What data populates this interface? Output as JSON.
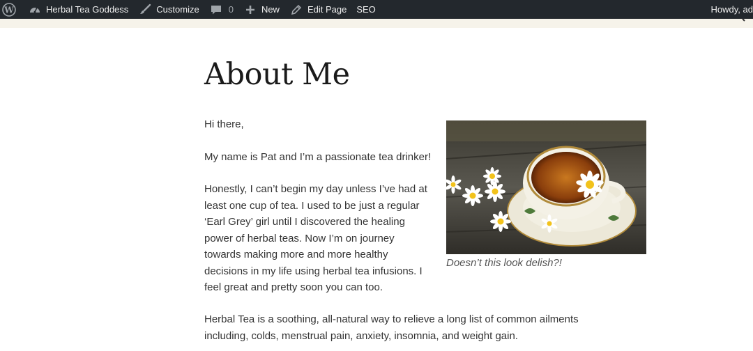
{
  "adminbar": {
    "wp_logo_icon": "wordpress-logo-icon",
    "site_name": "Herbal Tea Goddess",
    "customize": "Customize",
    "comments_count": "0",
    "new": "New",
    "edit_page": "Edit Page",
    "seo": "SEO",
    "howdy": "Howdy, ad"
  },
  "page": {
    "title": "About Me",
    "paragraphs": [
      "Hi there,",
      "My name is Pat and I’m a passionate tea drinker!",
      "Honestly, I can’t begin my day unless I’ve had at least one cup of tea. I used to be just a regular ‘Earl Grey’ girl until I discovered the healing power of herbal teas. Now I’m on journey towards making more and more healthy decisions in my life using herbal tea infusions. I feel great and pretty soon you can too.",
      "Herbal Tea is a soothing, all-natural way to relieve a long list of common ailments including, colds, menstrual pain, anxiety, insomnia, and weight gain."
    ],
    "image_caption": "Doesn’t this look delish?!"
  },
  "colors": {
    "adminbar_bg": "#23282d",
    "adminbar_text": "#eeeeee",
    "body_text": "#333333",
    "title_text": "#1a1a1a"
  }
}
